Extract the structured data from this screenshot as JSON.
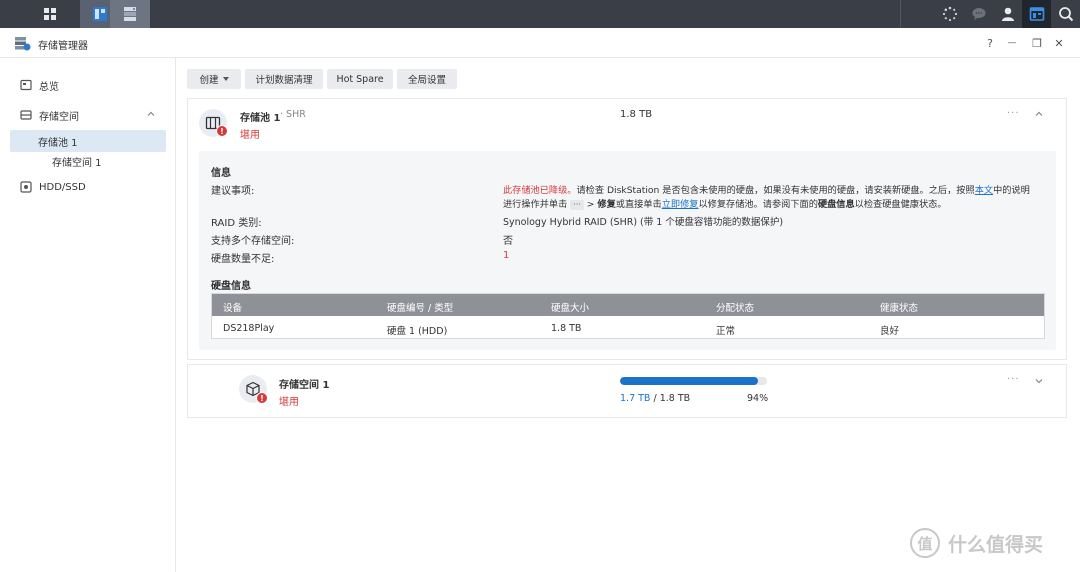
{
  "app": {
    "title": "存储管理器"
  },
  "window": {
    "help": "?",
    "minimize": "—",
    "restore": "❐",
    "close": "✕"
  },
  "sidebar": {
    "items": [
      {
        "label": "总览"
      },
      {
        "label": "存储空间"
      },
      {
        "label": "存储池 1"
      },
      {
        "label": "存储空间 1"
      },
      {
        "label": "HDD/SSD"
      }
    ]
  },
  "toolbar": {
    "create": "创建",
    "schedule": "计划数据清理",
    "hotspare": "Hot Spare",
    "global": "全局设置"
  },
  "pool": {
    "name": "存储池 1",
    "type": "· SHR",
    "status": "堪用",
    "size": "1.8 TB",
    "info": {
      "title": "信息",
      "suggest_label": "建议事项:",
      "suggest_red": "此存储池已降级。",
      "suggest_1": "请检查 DiskStation 是否包含未使用的硬盘，如果没有未使用的硬盘，请安装新硬盘。之后，按照",
      "suggest_link1": "本文",
      "suggest_2": "中的说明",
      "suggest_3": "进行操作并单击",
      "suggest_dots": "···",
      "suggest_4": "> ",
      "suggest_bold1": "修复",
      "suggest_5": "或直接单击",
      "suggest_link2": "立即修复",
      "suggest_6": "以修复存储池。请参阅下面的",
      "suggest_bold2": "硬盘信息",
      "suggest_7": "以检查硬盘健康状态。",
      "raid_label": "RAID 类别:",
      "raid_value": "Synology Hybrid RAID (SHR) (带 1 个硬盘容错功能的数据保护)",
      "multi_label": "支持多个存储空间:",
      "multi_value": "否",
      "missing_label": "硬盘数量不足:",
      "missing_value": "1"
    },
    "disk_info": {
      "title": "硬盘信息",
      "headers": [
        "设备",
        "硬盘编号 / 类型",
        "硬盘大小",
        "分配状态",
        "健康状态"
      ],
      "rows": [
        {
          "device": "DS218Play",
          "disk": "硬盘 1 (HDD)",
          "size": "1.8 TB",
          "alloc": "正常",
          "health": "良好"
        }
      ]
    }
  },
  "volume": {
    "name": "存储空间 1",
    "status": "堪用",
    "used": "1.7 TB",
    "total": "/ 1.8 TB",
    "percent": "94%",
    "usage_fraction": 0.94
  },
  "watermark": {
    "text": "什么值得买",
    "mark": "值"
  },
  "colors": {
    "accent": "#1a73c8",
    "danger": "#d63a3a",
    "ok": "#2f9e44"
  }
}
